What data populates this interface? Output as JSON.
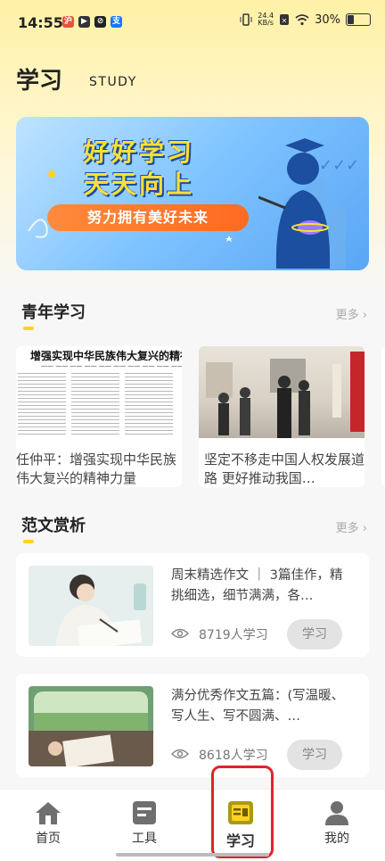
{
  "status_bar": {
    "time": "14:55",
    "net_speed_value": "24.4",
    "net_speed_unit": "KB/s",
    "battery": "30%"
  },
  "header": {
    "title": "学习",
    "subtitle": "STUDY"
  },
  "banner": {
    "line1": "好好学习",
    "line2": "天天向上",
    "slogan": "努力拥有美好未来"
  },
  "youth_section": {
    "title": "青年学习",
    "more_label": "更多",
    "cards": [
      {
        "caption": "任仲平：增强实现中华民族伟大复兴的精神力量",
        "headline": "增强实现中华民族伟大复兴的精神力量"
      },
      {
        "caption": "坚定不移走中国人权发展道路 更好推动我国…"
      }
    ]
  },
  "essay_section": {
    "title": "范文赏析",
    "more_label": "更多",
    "items": [
      {
        "title": "周末精选作文 ｜ 3篇佳作，精挑细选，细节满满，各…",
        "count": "8719人学习",
        "button": "学习"
      },
      {
        "title": "满分优秀作文五篇：(写温暖、写人生、写不圆满、…",
        "count": "8618人学习",
        "button": "学习"
      }
    ]
  },
  "bottom_nav": {
    "items": [
      {
        "label": "首页",
        "icon": "home-icon"
      },
      {
        "label": "工具",
        "icon": "document-icon"
      },
      {
        "label": "学习",
        "icon": "study-icon",
        "active": true
      },
      {
        "label": "我的",
        "icon": "person-icon"
      }
    ]
  },
  "colors": {
    "accent_yellow": "#ffd21f",
    "orange": "#ff6a21",
    "highlight_red": "#e2232a"
  }
}
